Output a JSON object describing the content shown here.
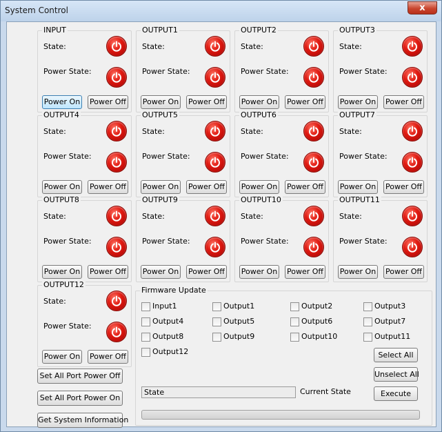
{
  "window": {
    "title": "System Control",
    "close_label": "x"
  },
  "labels": {
    "state": "State:",
    "power_state": "Power State:"
  },
  "buttons": {
    "power_on": "Power On",
    "power_off": "Power Off"
  },
  "ports": [
    {
      "name": "INPUT",
      "state": "off",
      "power_state": "off"
    },
    {
      "name": "OUTPUT1",
      "state": "off",
      "power_state": "off"
    },
    {
      "name": "OUTPUT2",
      "state": "off",
      "power_state": "off"
    },
    {
      "name": "OUTPUT3",
      "state": "off",
      "power_state": "off"
    },
    {
      "name": "OUTPUT4",
      "state": "off",
      "power_state": "off"
    },
    {
      "name": "OUTPUT5",
      "state": "off",
      "power_state": "off"
    },
    {
      "name": "OUTPUT6",
      "state": "off",
      "power_state": "off"
    },
    {
      "name": "OUTPUT7",
      "state": "off",
      "power_state": "off"
    },
    {
      "name": "OUTPUT8",
      "state": "off",
      "power_state": "off"
    },
    {
      "name": "OUTPUT9",
      "state": "off",
      "power_state": "off"
    },
    {
      "name": "OUTPUT10",
      "state": "off",
      "power_state": "off"
    },
    {
      "name": "OUTPUT11",
      "state": "off",
      "power_state": "off"
    },
    {
      "name": "OUTPUT12",
      "state": "off",
      "power_state": "off"
    }
  ],
  "power_icon": "power-icon",
  "power_icon_color": "#e11b12",
  "global_buttons": {
    "all_off": "Set All Port Power Off",
    "all_on": "Set All Port Power On",
    "sys_info": "Get System Information"
  },
  "firmware": {
    "title": "Firmware Update",
    "targets": [
      {
        "label": "Input1",
        "checked": false
      },
      {
        "label": "Output1",
        "checked": false
      },
      {
        "label": "Output2",
        "checked": false
      },
      {
        "label": "Output3",
        "checked": false
      },
      {
        "label": "Output4",
        "checked": false
      },
      {
        "label": "Output5",
        "checked": false
      },
      {
        "label": "Output6",
        "checked": false
      },
      {
        "label": "Output7",
        "checked": false
      },
      {
        "label": "Output8",
        "checked": false
      },
      {
        "label": "Output9",
        "checked": false
      },
      {
        "label": "Output10",
        "checked": false
      },
      {
        "label": "Output11",
        "checked": false
      },
      {
        "label": "Output12",
        "checked": false
      }
    ],
    "select_all": "Select All",
    "unselect_all": "Unselect All",
    "execute": "Execute",
    "state_value": "State",
    "current_state_label": "Current State",
    "progress": 0
  }
}
